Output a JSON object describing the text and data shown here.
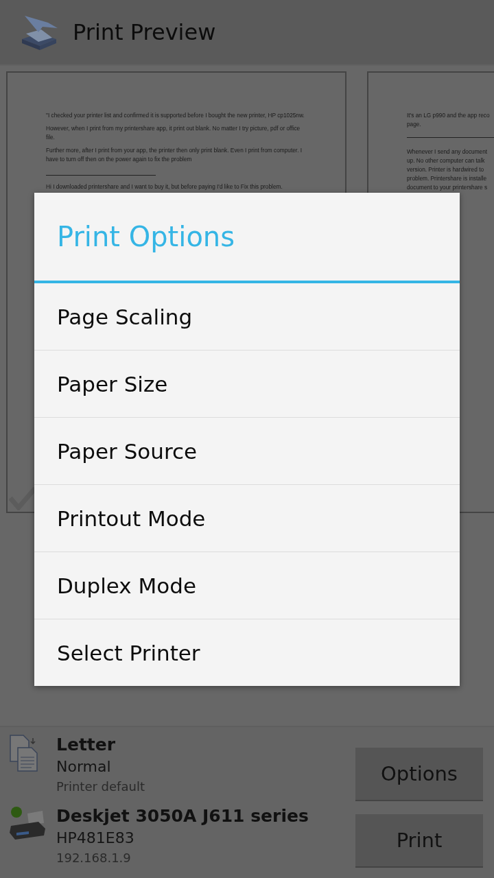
{
  "app_bar": {
    "title": "Print Preview"
  },
  "pages": [
    {
      "selected": true,
      "lines": [
        {
          "kind": "text",
          "text": "\"I checked your printer list and confirmed it is supported before I bought the new printer, HP cp1025nw."
        },
        {
          "kind": "text",
          "text": "However, when I print from my printershare app, it print out blank. No matter I try picture, pdf or office file."
        },
        {
          "kind": "text",
          "text": "Further more, after I print from your app, the printer then only print blank. Even I print from computer. I have to turn off then on the power again to fix the problem"
        },
        {
          "kind": "rule"
        },
        {
          "kind": "text",
          "text": "Hi I downloaded printershare and I want to buy it, but before paying I'd like to Fix this problem."
        }
      ]
    },
    {
      "lines": [
        {
          "kind": "text",
          "text": "It's an LG p990 and the app reco"
        },
        {
          "kind": "text",
          "text": "page."
        },
        {
          "kind": "rule"
        },
        {
          "kind": "text",
          "text": "Whenever I send any document"
        },
        {
          "kind": "text",
          "text": "up.  No other computer can talk"
        },
        {
          "kind": "text",
          "text": "version.  Printer is hardwired to"
        },
        {
          "kind": "text",
          "text": "problem.  Printershare is installe"
        },
        {
          "kind": "text",
          "text": "document to your printershare s"
        }
      ]
    }
  ],
  "dialog": {
    "title": "Print Options",
    "items": [
      "Page Scaling",
      "Paper Size",
      "Paper Source",
      "Printout Mode",
      "Duplex Mode",
      "Select Printer"
    ]
  },
  "paper": {
    "size": "Letter",
    "mode": "Normal",
    "source": "Printer default"
  },
  "printer": {
    "name": "Deskjet 3050A J611 series",
    "id": "HP481E83",
    "address": "192.168.1.9"
  },
  "buttons": [
    "Options",
    "Print"
  ]
}
